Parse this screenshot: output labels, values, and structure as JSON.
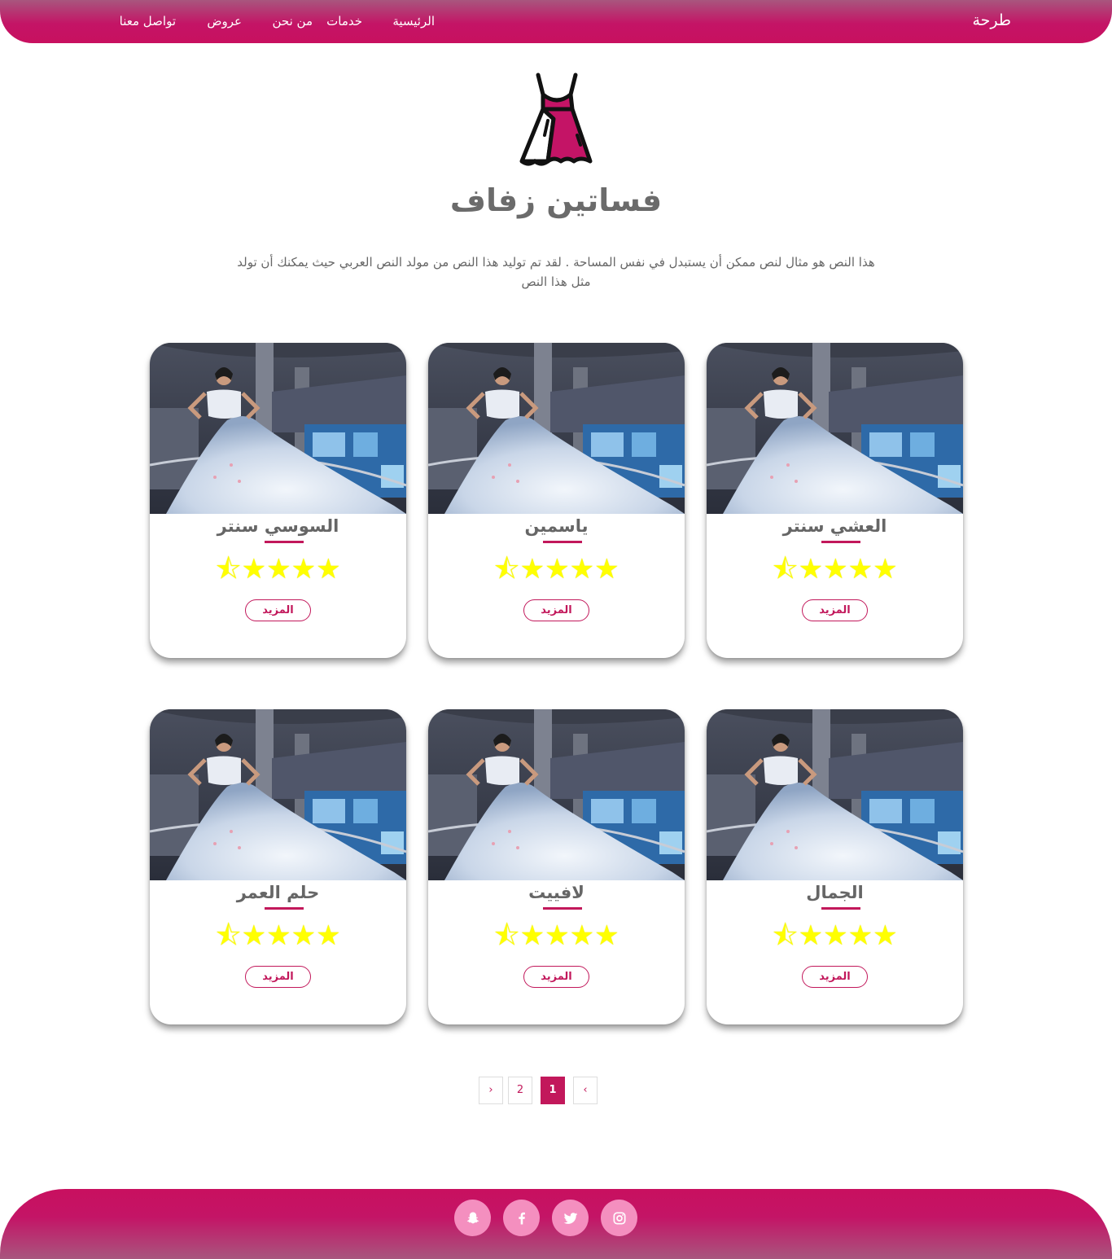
{
  "nav": {
    "brand": "طرحة",
    "home": "الرئيسية",
    "services": "خدمات",
    "about": "من نحن",
    "offers": "عروض",
    "contact": "تواصل معنا"
  },
  "hero": {
    "logo_icon": "dress-icon",
    "title": "فساتين زفاف",
    "description": "هذا النص هو مثال لنص ممكن أن يستبدل في نفس المساحة . لقد تم توليد هذا النص من مولد النص العربي حيث يمكنك أن تولد مثل هذا النص"
  },
  "colors": {
    "accent": "#c2185b",
    "star": "#ffff00",
    "social_bg": "#f48fbf"
  },
  "cards": [
    {
      "name": "العشي سنتر",
      "rating": 4.5,
      "button": "المزيد"
    },
    {
      "name": "ياسمين",
      "rating": 4.5,
      "button": "المزيد"
    },
    {
      "name": "السوسي سنتر",
      "rating": 4.5,
      "button": "المزيد"
    },
    {
      "name": "الجمال",
      "rating": 4.5,
      "button": "المزيد"
    },
    {
      "name": "لافييت",
      "rating": 4.5,
      "button": "المزيد"
    },
    {
      "name": "حلم العمر",
      "rating": 4.5,
      "button": "المزيد"
    }
  ],
  "pagination": {
    "prev": "‹",
    "pages": [
      "1",
      "2"
    ],
    "current": "1",
    "next": "›"
  },
  "footer": {
    "social_icons": [
      "instagram-icon",
      "twitter-icon",
      "facebook-icon",
      "snapchat-icon"
    ]
  }
}
